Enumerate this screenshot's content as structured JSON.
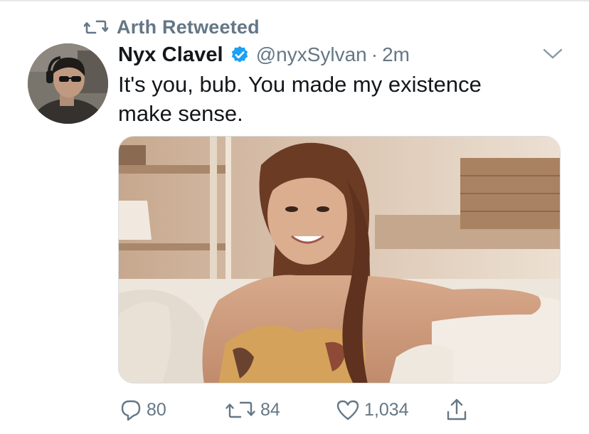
{
  "retweet": {
    "text": "Arth Retweeted"
  },
  "tweet": {
    "display_name": "Nyx Clavel",
    "handle": "@nyxSylvan",
    "separator": "·",
    "time": "2m",
    "text": "It's you, bub. You made my existence\nmake sense."
  },
  "actions": {
    "reply_count": "80",
    "retweet_count": "84",
    "like_count": "1,034"
  },
  "icons": {
    "retweet": "retweet-icon",
    "verified": "verified-badge-icon",
    "caret": "chevron-down-icon",
    "reply": "reply-icon",
    "like": "heart-icon",
    "share": "share-icon"
  },
  "colors": {
    "secondary_text": "#657786",
    "verified_blue": "#1da1f2",
    "primary_text": "#14171a"
  }
}
